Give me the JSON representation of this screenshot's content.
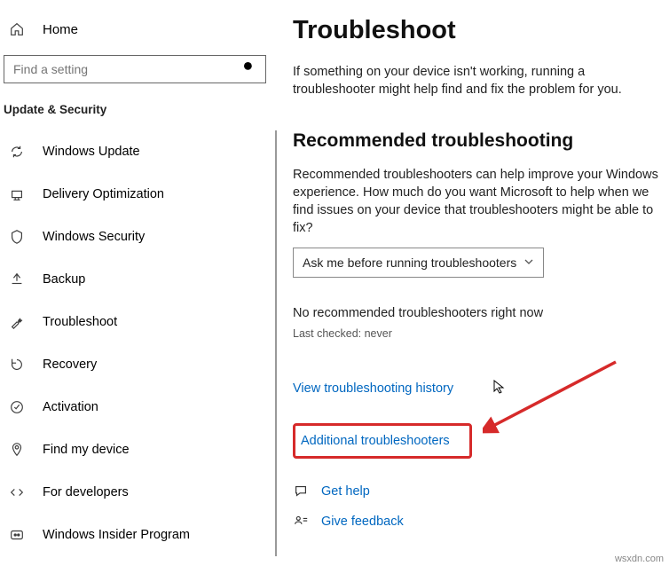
{
  "sidebar": {
    "home_label": "Home",
    "search_placeholder": "Find a setting",
    "section": "Update & Security",
    "items": [
      {
        "label": "Windows Update"
      },
      {
        "label": "Delivery Optimization"
      },
      {
        "label": "Windows Security"
      },
      {
        "label": "Backup"
      },
      {
        "label": "Troubleshoot"
      },
      {
        "label": "Recovery"
      },
      {
        "label": "Activation"
      },
      {
        "label": "Find my device"
      },
      {
        "label": "For developers"
      },
      {
        "label": "Windows Insider Program"
      }
    ]
  },
  "main": {
    "title": "Troubleshoot",
    "desc": "If something on your device isn't working, running a troubleshooter might help find and fix the problem for you.",
    "rec_title": "Recommended troubleshooting",
    "rec_desc": "Recommended troubleshooters can help improve your Windows experience. How much do you want Microsoft to help when we find issues on your device that troubleshooters might be able to fix?",
    "dropdown_value": "Ask me before running troubleshooters",
    "no_rec": "No recommended troubleshooters right now",
    "last_checked": "Last checked: never",
    "history_link": "View troubleshooting history",
    "additional_link": "Additional troubleshooters",
    "get_help": "Get help",
    "give_feedback": "Give feedback"
  },
  "watermark": "wsxdn.com"
}
